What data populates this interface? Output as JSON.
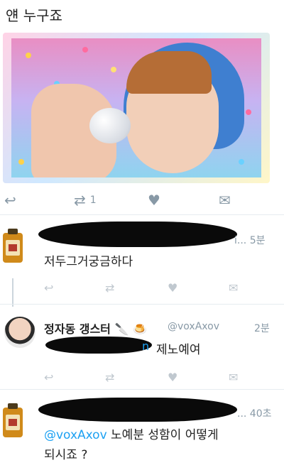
{
  "header": {
    "title": "얜 누구죠"
  },
  "main_tweet": {
    "actions": {
      "reply": "reply-icon",
      "retweet_count": "1",
      "like": "heart-icon",
      "message": "dm-icon"
    }
  },
  "reply1": {
    "time": "i... 5분",
    "text": "저두그거궁금하다"
  },
  "reply2": {
    "name": "정자동 갱스터",
    "handle": "@voxAxov",
    "time": "2분",
    "text_suffix": "제노예여",
    "partial_visible": "n"
  },
  "reply3": {
    "time": "... 40초",
    "mention": "@voxAxov",
    "text_line1": "노예분 성함이 어떻게",
    "text_line2": "되시죠 ?"
  },
  "colors": {
    "link": "#1da1f2",
    "muted": "#8899a6",
    "separator": "#e6ecf0"
  }
}
